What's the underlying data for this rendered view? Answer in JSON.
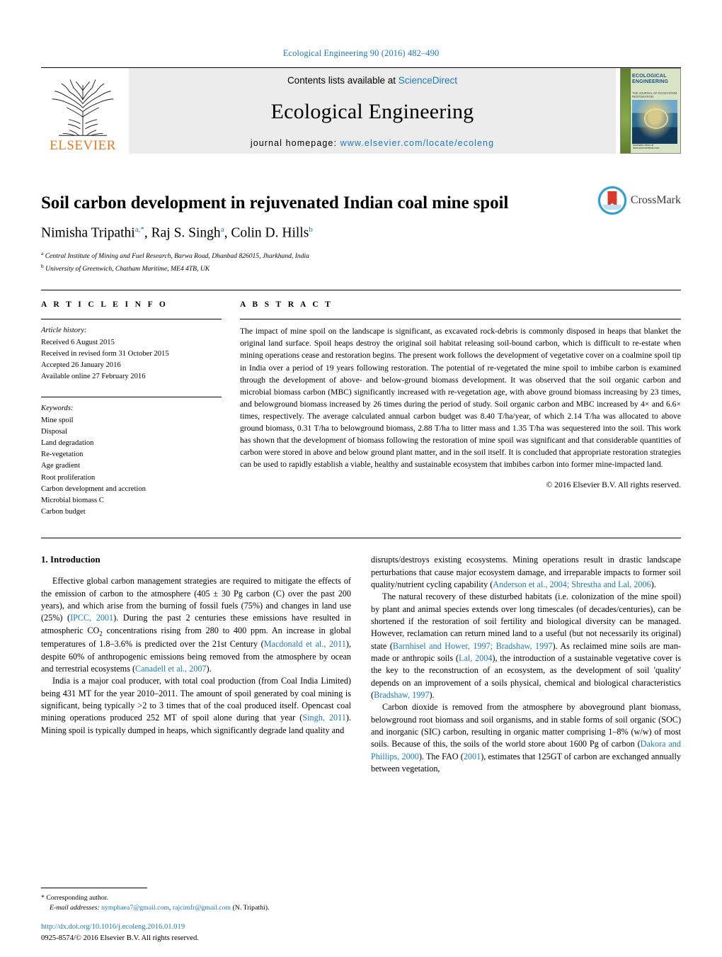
{
  "running_head": "Ecological Engineering 90 (2016) 482–490",
  "masthead": {
    "elsevier_label": "ELSEVIER",
    "contents_prefix": "Contents lists available at ",
    "contents_link": "ScienceDirect",
    "journal_name": "Ecological Engineering",
    "homepage_prefix": "journal homepage: ",
    "homepage_url": "www.elsevier.com/locate/ecoleng",
    "cover": {
      "title_line1": "ECOLOGICAL",
      "title_line2": "ENGINEERING",
      "subtitle": "THE JOURNAL OF ECOSYSTEM RESTORATION",
      "footer": "Available online at\nwww.sciencedirect.com"
    }
  },
  "article": {
    "title": "Soil carbon development in rejuvenated Indian coal mine spoil",
    "authors": [
      {
        "name": "Nimisha Tripathi",
        "marks": "a,*"
      },
      {
        "name": "Raj S. Singh",
        "marks": "a"
      },
      {
        "name": "Colin D. Hills",
        "marks": "b"
      }
    ],
    "affiliations": [
      {
        "mark": "a",
        "text": "Central Institute of Mining and Fuel Research, Barwa Road, Dhanbad 826015, Jharkhand, India"
      },
      {
        "mark": "b",
        "text": "University of Greenwich, Chatham Maritime, ME4 4TB, UK"
      }
    ],
    "crossmark_label": "CrossMark"
  },
  "article_info": {
    "heading": "A R T I C L E   I N F O",
    "history_label": "Article history:",
    "history": [
      "Received 6 August 2015",
      "Received in revised form 31 October 2015",
      "Accepted 26 January 2016",
      "Available online 27 February 2016"
    ],
    "keywords_label": "Keywords:",
    "keywords": [
      "Mine spoil",
      "Disposal",
      "Land degradation",
      "Re-vegetation",
      "Age gradient",
      "Root proliferation",
      "Carbon development and accretion",
      "Microbial biomass C",
      "Carbon budget"
    ]
  },
  "abstract": {
    "heading": "A B S T R A C T",
    "text": "The impact of mine spoil on the landscape is significant, as excavated rock-debris is commonly disposed in heaps that blanket the original land surface. Spoil heaps destroy the original soil habitat releasing soil-bound carbon, which is difficult to re-estate when mining operations cease and restoration begins. The present work follows the development of vegetative cover on a coalmine spoil tip in India over a period of 19 years following restoration. The potential of re-vegetated the mine spoil to imbibe carbon is examined through the development of above- and below-ground biomass development. It was observed that the soil organic carbon and microbial biomass carbon (MBC) significantly increased with re-vegetation age, with above ground biomass increasing by 23 times, and belowground biomass increased by 26 times during the period of study. Soil organic carbon and MBC increased by 4× and 6.6× times, respectively. The average calculated annual carbon budget was 8.40 T/ha/year, of which 2.14 T/ha was allocated to above ground biomass, 0.31 T/ha to belowground biomass, 2.88 T/ha to litter mass and 1.35 T/ha was sequestered into the soil. This work has shown that the development of biomass following the restoration of mine spoil was significant and that considerable quantities of carbon were stored in above and below ground plant matter, and in the soil itself. It is concluded that appropriate restoration strategies can be used to rapidly establish a viable, healthy and sustainable ecosystem that imbibes carbon into former mine-impacted land.",
    "copyright": "© 2016 Elsevier B.V. All rights reserved."
  },
  "introduction": {
    "heading": "1.  Introduction",
    "left_paragraphs": [
      "Effective global carbon management strategies are required to mitigate the effects of the emission of carbon to the atmosphere (405 ± 30 Pg carbon (C) over the past 200 years), and which arise from the burning of fossil fuels (75%) and changes in land use (25%) (IPCC, 2001). During the past 2 centuries these emissions have resulted in atmospheric CO2 concentrations rising from 280 to 400 ppm. An increase in global temperatures of 1.8–3.6% is predicted over the 21st Century (Macdonald et al., 2011), despite 60% of anthropogenic emissions being removed from the atmosphere by ocean and terrestrial ecosystems (Canadell et al., 2007).",
      "India is a major coal producer, with total coal production (from Coal India Limited) being 431 MT for the year 2010–2011. The amount of spoil generated by coal mining is significant, being typically >2 to 3 times that of the coal produced itself. Opencast coal mining operations produced 252 MT of spoil alone during that year (Singh, 2011). Mining spoil is typically dumped in heaps, which significantly degrade land quality and"
    ],
    "right_paragraphs": [
      "disrupts/destroys existing ecosystems. Mining operations result in drastic landscape perturbations that cause major ecosystem damage, and irreparable impacts to former soil quality/nutrient cycling capability (Anderson et al., 2004; Shrestha and Lal, 2006).",
      "The natural recovery of these disturbed habitats (i.e. colonization of the mine spoil) by plant and animal species extends over long timescales (of decades/centuries), can be shortened if the restoration of soil fertility and biological diversity can be managed. However, reclamation can return mined land to a useful (but not necessarily its original) state (Barnhisel and Hower, 1997; Bradshaw, 1997). As reclaimed mine soils are man-made or anthropic soils (Lal, 2004), the introduction of a sustainable vegetative cover is the key to the reconstruction of an ecosystem, as the development of soil 'quality' depends on an improvement of a soils physical, chemical and biological characteristics (Bradshaw, 1997).",
      "Carbon dioxide is removed from the atmosphere by aboveground plant biomass, belowground root biomass and soil organisms, and in stable forms of soil organic (SOC) and inorganic (SIC) carbon, resulting in organic matter comprising 1–8% (w/w) of most soils. Because of this, the soils of the world store about 1600 Pg of carbon (Dakora and Phillips, 2000). The FAO (2001), estimates that 125GT of carbon are exchanged annually between vegetation,"
    ]
  },
  "footnotes": {
    "corresponding_marker": "*",
    "corresponding_label": "Corresponding author.",
    "email_label": "E-mail addresses:",
    "email1": "nymphaea7@gmail.com",
    "email2": "rajcimfr@gmail.com",
    "email_suffix": "(N. Tripathi).",
    "doi": "http://dx.doi.org/10.1016/j.ecoleng.2016.01.019",
    "issn_line": "0925-8574/© 2016 Elsevier B.V. All rights reserved."
  },
  "colors": {
    "link": "#1a7bb9",
    "elsevier_orange": "#e87722",
    "masthead_bg": "#ececec"
  }
}
